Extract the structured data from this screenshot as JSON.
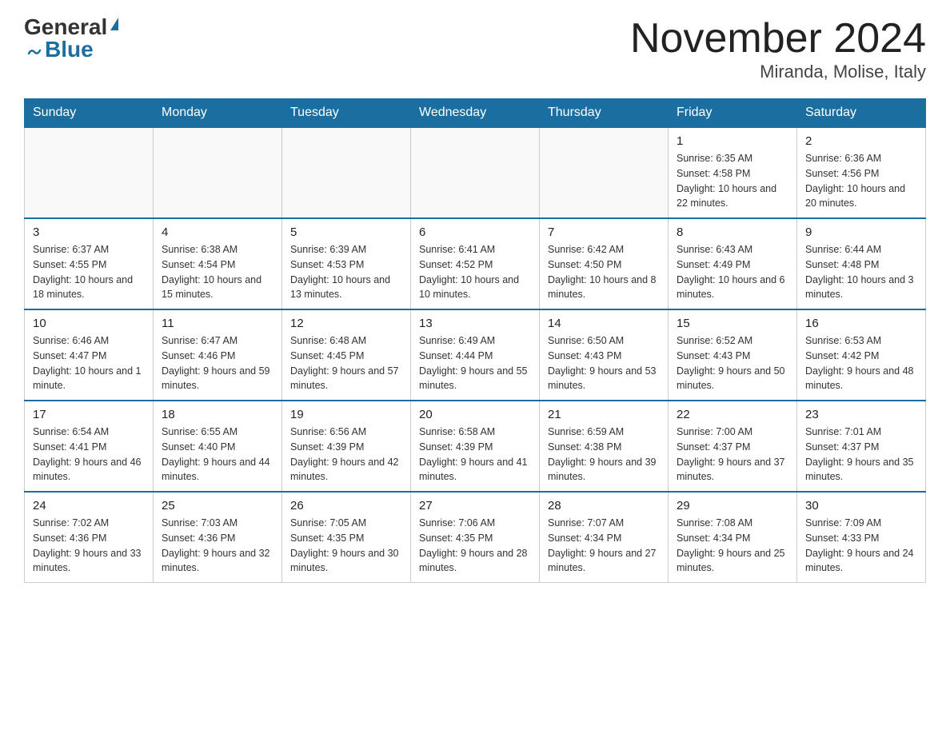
{
  "logo": {
    "general": "General",
    "blue": "Blue"
  },
  "title": "November 2024",
  "subtitle": "Miranda, Molise, Italy",
  "days_of_week": [
    "Sunday",
    "Monday",
    "Tuesday",
    "Wednesday",
    "Thursday",
    "Friday",
    "Saturday"
  ],
  "weeks": [
    [
      {
        "day": "",
        "sunrise": "",
        "sunset": "",
        "daylight": ""
      },
      {
        "day": "",
        "sunrise": "",
        "sunset": "",
        "daylight": ""
      },
      {
        "day": "",
        "sunrise": "",
        "sunset": "",
        "daylight": ""
      },
      {
        "day": "",
        "sunrise": "",
        "sunset": "",
        "daylight": ""
      },
      {
        "day": "",
        "sunrise": "",
        "sunset": "",
        "daylight": ""
      },
      {
        "day": "1",
        "sunrise": "Sunrise: 6:35 AM",
        "sunset": "Sunset: 4:58 PM",
        "daylight": "Daylight: 10 hours and 22 minutes."
      },
      {
        "day": "2",
        "sunrise": "Sunrise: 6:36 AM",
        "sunset": "Sunset: 4:56 PM",
        "daylight": "Daylight: 10 hours and 20 minutes."
      }
    ],
    [
      {
        "day": "3",
        "sunrise": "Sunrise: 6:37 AM",
        "sunset": "Sunset: 4:55 PM",
        "daylight": "Daylight: 10 hours and 18 minutes."
      },
      {
        "day": "4",
        "sunrise": "Sunrise: 6:38 AM",
        "sunset": "Sunset: 4:54 PM",
        "daylight": "Daylight: 10 hours and 15 minutes."
      },
      {
        "day": "5",
        "sunrise": "Sunrise: 6:39 AM",
        "sunset": "Sunset: 4:53 PM",
        "daylight": "Daylight: 10 hours and 13 minutes."
      },
      {
        "day": "6",
        "sunrise": "Sunrise: 6:41 AM",
        "sunset": "Sunset: 4:52 PM",
        "daylight": "Daylight: 10 hours and 10 minutes."
      },
      {
        "day": "7",
        "sunrise": "Sunrise: 6:42 AM",
        "sunset": "Sunset: 4:50 PM",
        "daylight": "Daylight: 10 hours and 8 minutes."
      },
      {
        "day": "8",
        "sunrise": "Sunrise: 6:43 AM",
        "sunset": "Sunset: 4:49 PM",
        "daylight": "Daylight: 10 hours and 6 minutes."
      },
      {
        "day": "9",
        "sunrise": "Sunrise: 6:44 AM",
        "sunset": "Sunset: 4:48 PM",
        "daylight": "Daylight: 10 hours and 3 minutes."
      }
    ],
    [
      {
        "day": "10",
        "sunrise": "Sunrise: 6:46 AM",
        "sunset": "Sunset: 4:47 PM",
        "daylight": "Daylight: 10 hours and 1 minute."
      },
      {
        "day": "11",
        "sunrise": "Sunrise: 6:47 AM",
        "sunset": "Sunset: 4:46 PM",
        "daylight": "Daylight: 9 hours and 59 minutes."
      },
      {
        "day": "12",
        "sunrise": "Sunrise: 6:48 AM",
        "sunset": "Sunset: 4:45 PM",
        "daylight": "Daylight: 9 hours and 57 minutes."
      },
      {
        "day": "13",
        "sunrise": "Sunrise: 6:49 AM",
        "sunset": "Sunset: 4:44 PM",
        "daylight": "Daylight: 9 hours and 55 minutes."
      },
      {
        "day": "14",
        "sunrise": "Sunrise: 6:50 AM",
        "sunset": "Sunset: 4:43 PM",
        "daylight": "Daylight: 9 hours and 53 minutes."
      },
      {
        "day": "15",
        "sunrise": "Sunrise: 6:52 AM",
        "sunset": "Sunset: 4:43 PM",
        "daylight": "Daylight: 9 hours and 50 minutes."
      },
      {
        "day": "16",
        "sunrise": "Sunrise: 6:53 AM",
        "sunset": "Sunset: 4:42 PM",
        "daylight": "Daylight: 9 hours and 48 minutes."
      }
    ],
    [
      {
        "day": "17",
        "sunrise": "Sunrise: 6:54 AM",
        "sunset": "Sunset: 4:41 PM",
        "daylight": "Daylight: 9 hours and 46 minutes."
      },
      {
        "day": "18",
        "sunrise": "Sunrise: 6:55 AM",
        "sunset": "Sunset: 4:40 PM",
        "daylight": "Daylight: 9 hours and 44 minutes."
      },
      {
        "day": "19",
        "sunrise": "Sunrise: 6:56 AM",
        "sunset": "Sunset: 4:39 PM",
        "daylight": "Daylight: 9 hours and 42 minutes."
      },
      {
        "day": "20",
        "sunrise": "Sunrise: 6:58 AM",
        "sunset": "Sunset: 4:39 PM",
        "daylight": "Daylight: 9 hours and 41 minutes."
      },
      {
        "day": "21",
        "sunrise": "Sunrise: 6:59 AM",
        "sunset": "Sunset: 4:38 PM",
        "daylight": "Daylight: 9 hours and 39 minutes."
      },
      {
        "day": "22",
        "sunrise": "Sunrise: 7:00 AM",
        "sunset": "Sunset: 4:37 PM",
        "daylight": "Daylight: 9 hours and 37 minutes."
      },
      {
        "day": "23",
        "sunrise": "Sunrise: 7:01 AM",
        "sunset": "Sunset: 4:37 PM",
        "daylight": "Daylight: 9 hours and 35 minutes."
      }
    ],
    [
      {
        "day": "24",
        "sunrise": "Sunrise: 7:02 AM",
        "sunset": "Sunset: 4:36 PM",
        "daylight": "Daylight: 9 hours and 33 minutes."
      },
      {
        "day": "25",
        "sunrise": "Sunrise: 7:03 AM",
        "sunset": "Sunset: 4:36 PM",
        "daylight": "Daylight: 9 hours and 32 minutes."
      },
      {
        "day": "26",
        "sunrise": "Sunrise: 7:05 AM",
        "sunset": "Sunset: 4:35 PM",
        "daylight": "Daylight: 9 hours and 30 minutes."
      },
      {
        "day": "27",
        "sunrise": "Sunrise: 7:06 AM",
        "sunset": "Sunset: 4:35 PM",
        "daylight": "Daylight: 9 hours and 28 minutes."
      },
      {
        "day": "28",
        "sunrise": "Sunrise: 7:07 AM",
        "sunset": "Sunset: 4:34 PM",
        "daylight": "Daylight: 9 hours and 27 minutes."
      },
      {
        "day": "29",
        "sunrise": "Sunrise: 7:08 AM",
        "sunset": "Sunset: 4:34 PM",
        "daylight": "Daylight: 9 hours and 25 minutes."
      },
      {
        "day": "30",
        "sunrise": "Sunrise: 7:09 AM",
        "sunset": "Sunset: 4:33 PM",
        "daylight": "Daylight: 9 hours and 24 minutes."
      }
    ]
  ]
}
